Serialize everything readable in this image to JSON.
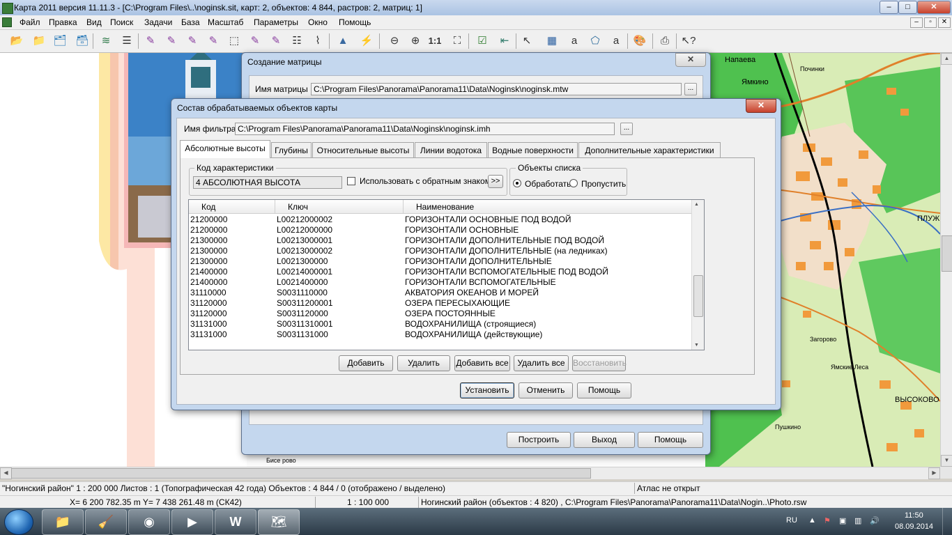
{
  "window": {
    "title": "Карта 2011 версия 11.11.3 - [C:\\Program Files\\..\\noginsk.sit, карт: 2, объектов: 4 844, растров: 2, матриц: 1]",
    "min": "–",
    "max": "□",
    "close": "✕"
  },
  "menu": [
    "Файл",
    "Правка",
    "Вид",
    "Поиск",
    "Задачи",
    "База",
    "Масштаб",
    "Параметры",
    "Окно",
    "Помощь"
  ],
  "toolbar_scale_label": "1:1",
  "map_labels": {
    "napaeva": "Напаева",
    "yamkino": "Ямкино",
    "pochinki": "Починки",
    "pluzh": "ПЛУЖ",
    "yamskie_lesa": "Ямские Леса",
    "vysokovo": "ВЫСОКОВО",
    "pushkino": "Пушкино",
    "zagorovo": "Загорово",
    "biserovo": "Бисе рово"
  },
  "dlg_matrix": {
    "title": "Создание матрицы",
    "name_label": "Имя матрицы",
    "name_value": "C:\\Program Files\\Panorama\\Panorama11\\Data\\Noginsk\\noginsk.mtw",
    "browse": "...",
    "close": "✕",
    "btn_build": "Построить",
    "btn_exit": "Выход",
    "btn_help": "Помощь"
  },
  "dlg_objects": {
    "title": "Состав обрабатываемых объектов карты",
    "close": "✕",
    "filter_label": "Имя фильтра",
    "filter_value": "C:\\Program Files\\Panorama\\Panorama11\\Data\\Noginsk\\noginsk.imh",
    "browse": "...",
    "tabs": [
      "Абсолютные высоты",
      "Глубины",
      "Относительные высоты",
      "Линии водотока",
      "Водные поверхности",
      "Дополнительные характеристики"
    ],
    "code_group_label": "Код характеристики",
    "code_value": "4  АБСОЛЮТНАЯ ВЫСОТА",
    "reverse_label": "Использовать с обратным знаком",
    "arrow_btn": ">>",
    "objects_group_label": "Объекты  списка",
    "radio_process": "Обработать",
    "radio_skip": "Пропустить",
    "columns": [
      "Код",
      "Ключ",
      "Наименование"
    ],
    "rows": [
      [
        "21200000",
        "L00212000002",
        "ГОРИЗОНТАЛИ ОСНОВНЫЕ ПОД ВОДОЙ"
      ],
      [
        "21200000",
        "L00212000000",
        "ГОРИЗОНТАЛИ ОСНОВНЫЕ"
      ],
      [
        "21300000",
        "L00213000001",
        "ГОРИЗОНТАЛИ ДОПОЛНИТЕЛЬНЫЕ ПОД ВОДОЙ"
      ],
      [
        "21300000",
        "L00213000002",
        "ГОРИЗОНТАЛИ ДОПОЛНИТЕЛЬНЫЕ (на ледниках)"
      ],
      [
        "21300000",
        "L0021300000",
        "ГОРИЗОНТАЛИ ДОПОЛНИТЕЛЬНЫЕ"
      ],
      [
        "21400000",
        "L00214000001",
        "ГОРИЗОНТАЛИ ВСПОМОГАТЕЛЬНЫЕ ПОД ВОДОЙ"
      ],
      [
        "21400000",
        "L0021400000",
        "ГОРИЗОНТАЛИ ВСПОМОГАТЕЛЬНЫЕ"
      ],
      [
        "31110000",
        "S0031110000",
        "АКВАТОРИЯ ОКЕАНОВ И МОРЕЙ"
      ],
      [
        "31120000",
        "S00311200001",
        "ОЗЕРА ПЕРЕСЫХАЮЩИЕ"
      ],
      [
        "31120000",
        "S0031120000",
        "ОЗЕРА ПОСТОЯННЫЕ"
      ],
      [
        "31131000",
        "S00311310001",
        "ВОДОХРАНИЛИЩА (строящиеся)"
      ],
      [
        "31131000",
        "S0031131000",
        "ВОДОХРАНИЛИЩА (действующие)"
      ]
    ],
    "btn_add": "Добавить",
    "btn_delete": "Удалить",
    "btn_add_all": "Добавить все",
    "btn_delete_all": "Удалить все",
    "btn_restore": "Восстановить",
    "btn_set": "Установить",
    "btn_cancel": "Отменить",
    "btn_help": "Помощь"
  },
  "status1": {
    "region": "\"Ногинский район\"  1 : 200 000   Листов : 1   (Топографическая 42 года)  Объектов : 4 844 / 0 (отображено / выделено)",
    "atlas": "Атлас не открыт"
  },
  "status2": {
    "coords": "X= 6 200 782.35 m     Y= 7 438 261.48 m   (СК42)",
    "scale": "1 : 100 000",
    "info": "Ногинский район   (объектов : 4 820) , C:\\Program Files\\Panorama\\Panorama11\\Data\\Nogin..\\Photo.rsw"
  },
  "taskbar": {
    "lang": "RU",
    "time": "11:50",
    "date": "08.09.2014"
  }
}
